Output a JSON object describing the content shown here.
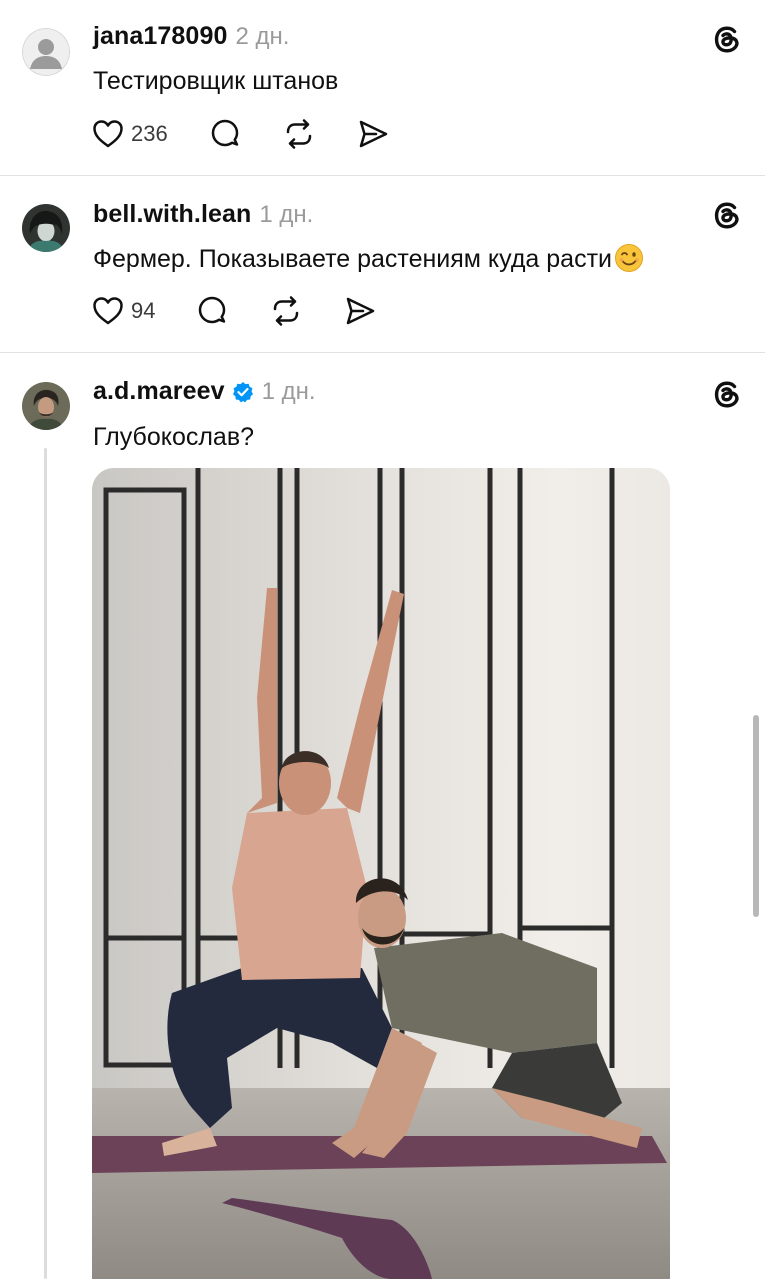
{
  "posts": [
    {
      "username": "jana178090",
      "time": "2 дн.",
      "text": "Тестировщик штанов",
      "likes": "236",
      "avatar": "default-avatar-icon"
    },
    {
      "username": "bell.with.lean",
      "time": "1 дн.",
      "text": "Фермер. Показываете растениям куда расти",
      "emoji": "winking-face",
      "likes": "94",
      "avatar": "user-photo"
    },
    {
      "username": "a.d.mareev",
      "verified": true,
      "time": "1 дн.",
      "text": "Глубокослав?",
      "avatar": "user-photo",
      "image": "yoga-photo"
    }
  ],
  "icons": {
    "like": "heart-icon",
    "reply": "comment-icon",
    "repost": "repost-icon",
    "share": "share-icon",
    "app": "threads-logo-icon"
  },
  "colors": {
    "text": "#101010",
    "muted": "#9a9a9a",
    "verified": "#0095f6",
    "divider": "#e2e2e2"
  }
}
